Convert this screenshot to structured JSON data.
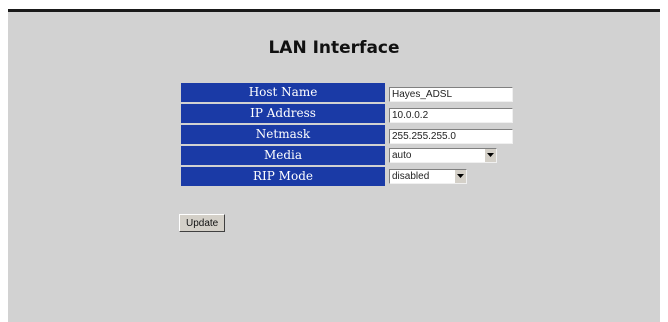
{
  "page": {
    "title": "LAN Interface"
  },
  "form": {
    "host_name": {
      "label": "Host Name",
      "value": "Hayes_ADSL"
    },
    "ip_address": {
      "label": "IP Address",
      "value": "10.0.0.2"
    },
    "netmask": {
      "label": "Netmask",
      "value": "255.255.255.0"
    },
    "media": {
      "label": "Media",
      "value": "auto"
    },
    "rip_mode": {
      "label": "RIP Mode",
      "value": "disabled"
    }
  },
  "actions": {
    "update_label": "Update"
  },
  "colors": {
    "label_background": "#1a3aa6",
    "panel_background": "#d2d2d2",
    "label_text": "#ffffff"
  },
  "icons": {
    "dropdown": "chevron-down-icon"
  }
}
